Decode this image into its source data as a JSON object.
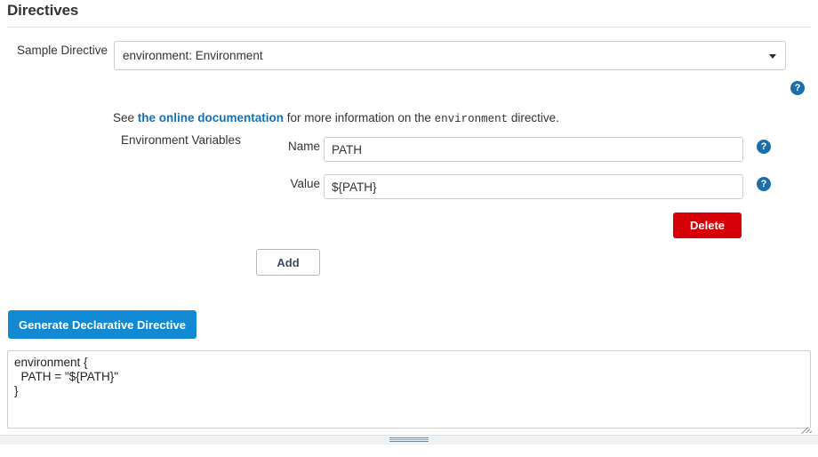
{
  "page": {
    "title": "Directives"
  },
  "sample_directive": {
    "label": "Sample Directive",
    "selected": "environment: Environment",
    "options": [
      "environment: Environment"
    ],
    "arrow_icon": "chevron-down-icon",
    "help_icon": "help-circle-icon"
  },
  "documentation": {
    "prefix": "See ",
    "link_text": "the online documentation",
    "middle": " for more information on the ",
    "directive_name": "environment",
    "suffix": " directive."
  },
  "env_vars": {
    "section_label": "Environment Variables",
    "name_field": {
      "label": "Name",
      "value": "PATH",
      "placeholder": "",
      "help_icon": "help-circle-icon"
    },
    "value_field": {
      "label": "Value",
      "value": "${PATH}",
      "placeholder": "",
      "help_icon": "help-circle-icon"
    },
    "delete_label": "Delete",
    "add_label": "Add"
  },
  "generate": {
    "button_label": "Generate Declarative Directive",
    "output": "environment {\n  PATH = \"${PATH}\"\n}"
  },
  "colors": {
    "accent_blue": "#1189d3",
    "link_blue": "#1a6fa8",
    "help_blue": "#1a6fa8",
    "danger_red": "#d60008",
    "text": "#333333",
    "border": "#cccccc",
    "splitter_bg": "#eef2f5"
  },
  "splitter": {
    "grip_icon": "drag-handle-icon"
  },
  "resize": {
    "grip_icon": "resize-corner-icon"
  }
}
